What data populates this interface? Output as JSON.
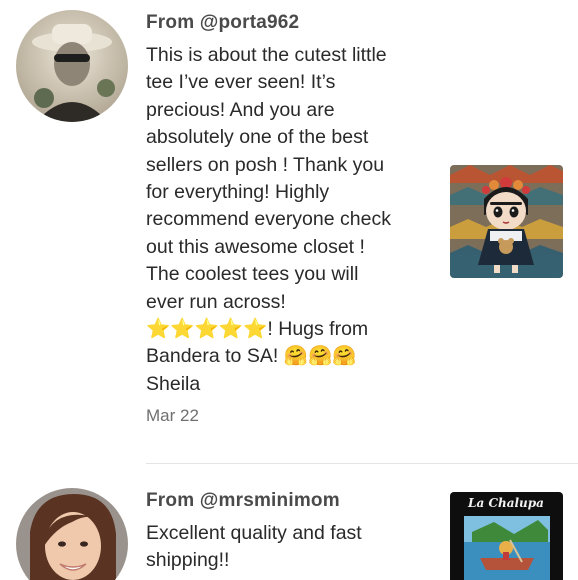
{
  "reviews": [
    {
      "from": "From @porta962",
      "body": "This is about the cutest little\ntee I’ve ever seen! It’s\nprecious! And you are\nabsolutely one of the best\nsellers on posh ! Thank you\nfor everything! Highly\nrecommend everyone check\nout this awesome closet !\nThe coolest tees you will\never run across!\n⭐⭐⭐⭐⭐! Hugs from\nBandera to SA! 🤗🤗🤗\nSheila",
      "date": "Mar 22",
      "thumb_alt": "Frida Kahlo chibi tee"
    },
    {
      "from": "From @mrsminimom",
      "body": "Excellent quality and fast\nshipping!!",
      "thumb_title": "La Chalupa"
    }
  ],
  "colors": {
    "from_text": "#4a4a4a",
    "body_text": "#2a2a2a",
    "date_text": "#6f6f6f",
    "divider": "#e4e4e4",
    "star": "#f5b800"
  }
}
